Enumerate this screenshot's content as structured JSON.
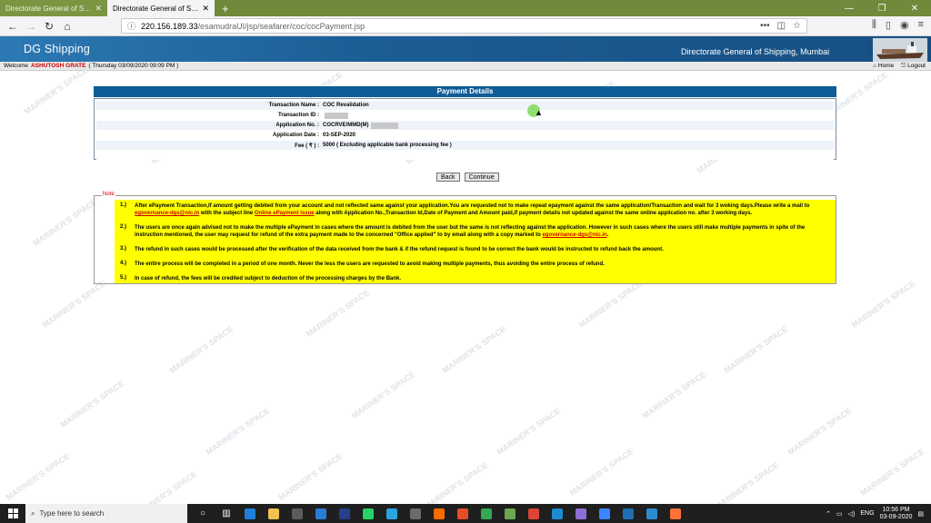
{
  "browser": {
    "tabs": [
      {
        "title": "Directorate General of Shipping - C...",
        "active": false
      },
      {
        "title": "Directorate General of Shipping",
        "active": true
      }
    ],
    "url_host": "220.156.189.33",
    "url_path": "/esamudraUI/jsp/seafarer/coc/cocPayment.jsp"
  },
  "site": {
    "logo": "DG Shipping",
    "org_name": "Directorate General of Shipping, Mumbai",
    "welcome_label": "Welcome",
    "user_name": "ASHUTOSH GRATE",
    "date_text": "( Thursday 03/09/2020 09:09 PM )",
    "home_link": "Home",
    "logout_link": "Logout"
  },
  "payment": {
    "title": "Payment Details",
    "rows": [
      {
        "label": "Transaction Name :",
        "value": "COC Revalidation"
      },
      {
        "label": "Transaction ID :",
        "value": ""
      },
      {
        "label": "Application No. :",
        "value": "COCRVE/MMD(M)"
      },
      {
        "label": "Application Date :",
        "value": "03-SEP-2020"
      },
      {
        "label": "Fee ( ₹ ) :",
        "value": "5000  ( Excluding applicable bank processing fee )"
      }
    ],
    "back_label": "Back",
    "continue_label": "Continue"
  },
  "note": {
    "legend": "Note",
    "items": [
      {
        "num": "1.)",
        "parts": [
          "After ePayment Transaction,If amount getting debited from your account and not reflected same against your application.You are requested not to make repeat epayment against the same application/Transaction and wait for 3 woking days.Please write a mail to ",
          "egovernance-dgs@nic.in",
          " with the subject line ",
          "Online ePayment issue",
          " along with Application No.,Transaction Id,Date of Payment and Amount paid,if payment details not updated against the same online application no. after 3 working days."
        ]
      },
      {
        "num": "2.)",
        "parts": [
          "The users are once again advised not to make the multiple ePayment in cases where the amount is debited from the user but the same is not reflecting against the application. However in such cases where the users still make multiple payments in spite of the instruction mentioned, the user may request for refund of the extra payment made to the concerned \"Office applied\" to by email along with a copy marked to ",
          "egovernance-dgs@nic.in",
          "."
        ]
      },
      {
        "num": "3.)",
        "parts": [
          "The refund in such cases would be processed after the verification of the data received from the bank & if the refund request is found to be correct the bank would be instructed to refund back the amount."
        ]
      },
      {
        "num": "4.)",
        "parts": [
          "The entire process will be completed in a period of one month. Never the less the users are requested to avoid making multiple payments, thus avoiding the entire process of refund."
        ]
      },
      {
        "num": "5.)",
        "parts": [
          "In case of refund, the fees will be credited subject to deduction of the processing charges by the Bank."
        ]
      }
    ]
  },
  "watermark": "MARINER'S SPACE",
  "taskbar": {
    "search_placeholder": "Type here to search",
    "lang": "ENG",
    "time": "10:56 PM",
    "date": "03-09-2020"
  },
  "colors": {
    "tabbar": "#6e8a3a",
    "header_blue": "#1b5d95",
    "note_yellow": "#ffff00",
    "link_red": "#cc0000"
  }
}
